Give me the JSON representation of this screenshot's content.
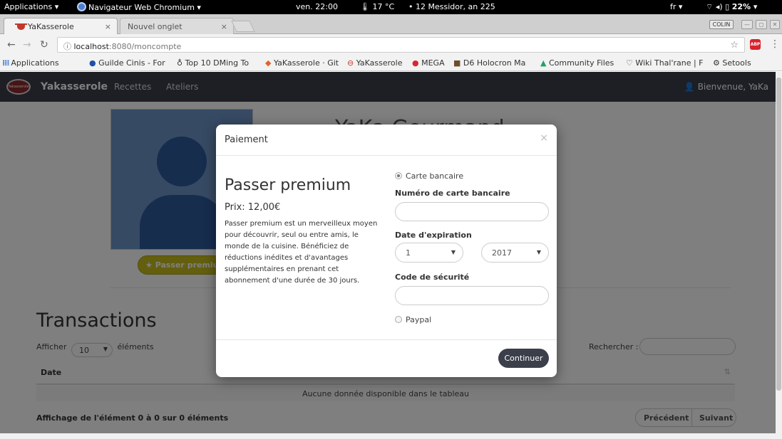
{
  "topbar": {
    "applications": "Applications ▾",
    "window_title": "Navigateur Web Chromium ▾",
    "clock": "ven. 22:00",
    "weather": "🌡 17 °C",
    "calendar": "• 12 Messidor, an 225",
    "lang": "fr ▾",
    "battery": "22% ▾"
  },
  "tabs": [
    {
      "label": "YaKasserole",
      "close": "×"
    },
    {
      "label": "Nouvel onglet",
      "close": "×"
    }
  ],
  "window_user": "COLIN",
  "address": {
    "host": "localhost",
    "path": ":8080/moncompte"
  },
  "bookmarks": [
    {
      "label": "Applications"
    },
    {
      "label": "Guilde Cinis - For"
    },
    {
      "label": "Top 10 DMing To"
    },
    {
      "label": "YaKasserole · Git"
    },
    {
      "label": "YaKasserole"
    },
    {
      "label": "MEGA"
    },
    {
      "label": "D6 Holocron Ma"
    },
    {
      "label": "Community Files"
    },
    {
      "label": "Wiki Thal'rane | F"
    },
    {
      "label": "Setools"
    }
  ],
  "appnav": {
    "logo_text": "Yakasserole",
    "brand": "Yakasserole",
    "links": [
      "Recettes",
      "Ateliers"
    ],
    "welcome": "Bienvenue, YaKa"
  },
  "profile": {
    "name_partial": "YaKa Gourmand",
    "premium_button": "★ Passer premium"
  },
  "transactions": {
    "title": "Transactions",
    "show_prefix": "Afficher",
    "page_size": "10",
    "show_suffix": "éléments",
    "search_label": "Rechercher :",
    "column": "Date",
    "empty": "Aucune donnée disponible dans le tableau",
    "info": "Affichage de l'élément 0 à 0 sur 0 éléments",
    "prev": "Précédent",
    "next": "Suivant"
  },
  "modal": {
    "title": "Paiement",
    "close": "×",
    "heading": "Passer premium",
    "price": "Prix: 12,00€",
    "description": "Passer premium est un merveilleux moyen pour découvrir, seul ou entre amis, le monde de la cuisine. Bénéficiez de réductions inédites et d'avantages supplémentaires en prenant cet abonnement d'une durée de 30 jours.",
    "card_option": "Carte bancaire",
    "card_number_label": "Numéro de carte bancaire",
    "expiry_label": "Date d'expiration",
    "expiry_month": "1",
    "expiry_year": "2017",
    "cvc_label": "Code de sécurité",
    "paypal_option": "Paypal",
    "submit": "Continuer"
  }
}
